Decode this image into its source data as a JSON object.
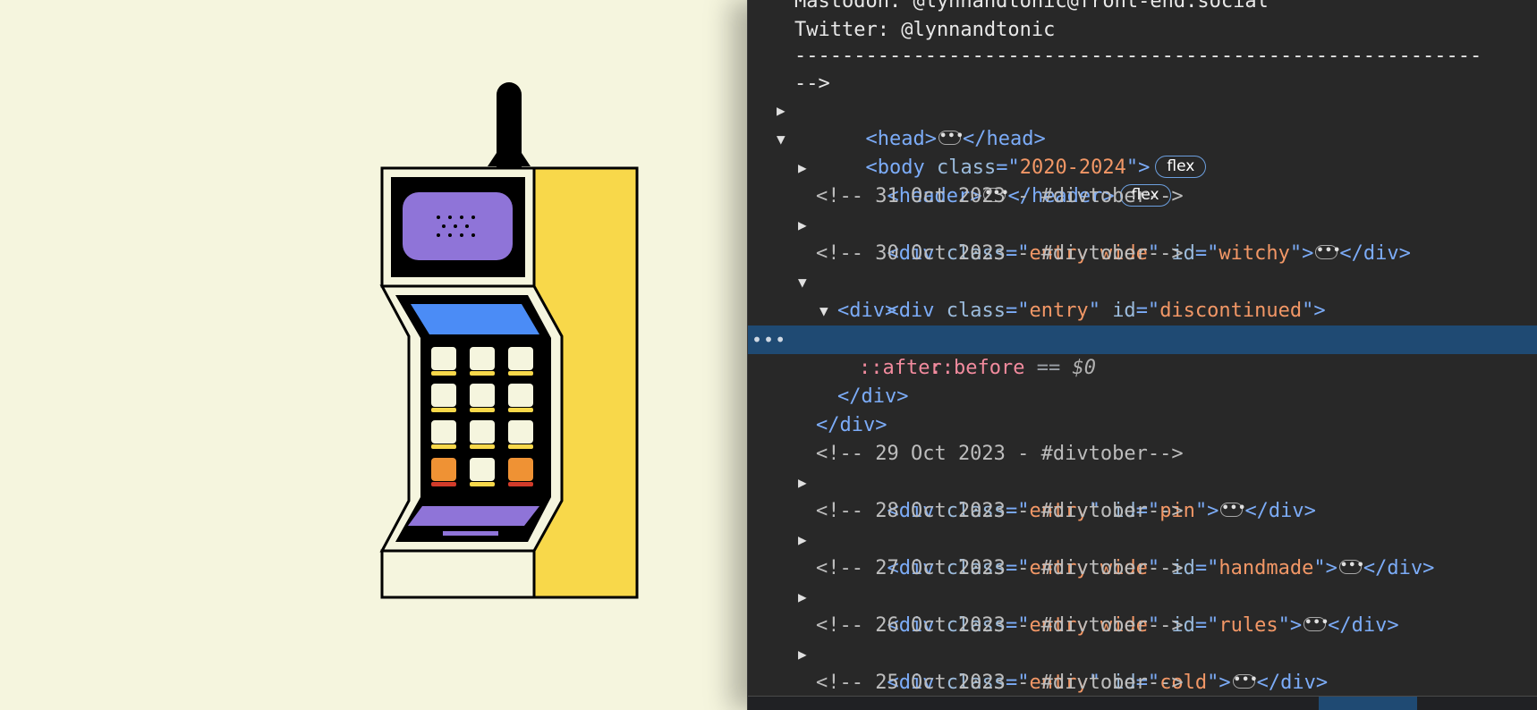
{
  "devtools": {
    "lines": [
      {
        "id": "l0",
        "text": "Mastodon: @lynnandtonic@front-end.social"
      },
      {
        "id": "l1",
        "text": "Twitter: @lynnandtonic"
      },
      {
        "id": "l2",
        "text": "----------------------------------------------------------"
      },
      {
        "id": "l3",
        "text": "-->"
      },
      {
        "id": "l4",
        "open": "<head>",
        "close": "</head>"
      },
      {
        "id": "l5",
        "tag": "<body",
        "attr": "class",
        "value": "2020-2024",
        "end": ">",
        "badge": "flex"
      },
      {
        "id": "l6",
        "open": "<header>",
        "close": "</header>",
        "badge": "flex"
      },
      {
        "id": "l7",
        "comment": "<!-- 31 Oct 2023 - #divtober-->"
      },
      {
        "id": "l8",
        "tag": "<div",
        "attr": "class",
        "value": "entry wide",
        "attr2": "id",
        "value2": "witchy",
        "close": "</div>"
      },
      {
        "id": "l9",
        "comment": "<!-- 30 Oct 2023 - #divtober-->"
      },
      {
        "id": "l10",
        "tag": "<div",
        "attr": "class",
        "value": "entry",
        "attr2": "id",
        "value2": "discontinued",
        "end": ">"
      },
      {
        "id": "l11",
        "tag": "<div>"
      },
      {
        "id": "l12",
        "pseudo": "::before",
        "eq": "==",
        "var": "$0"
      },
      {
        "id": "l13",
        "pseudo": "::after"
      },
      {
        "id": "l14",
        "tag": "</div>"
      },
      {
        "id": "l15",
        "tag": "</div>"
      },
      {
        "id": "l16",
        "comment": "<!-- 29 Oct 2023 - #divtober-->"
      },
      {
        "id": "l17",
        "tag": "<div",
        "attr": "class",
        "value": "entry",
        "attr2": "id",
        "value2": "pin",
        "close": "</div>"
      },
      {
        "id": "l18",
        "comment": "<!-- 28 Oct 2023 - #divtober-->"
      },
      {
        "id": "l19",
        "tag": "<div",
        "attr": "class",
        "value": "entry wide",
        "attr2": "id",
        "value2": "handmade",
        "close": "</div>"
      },
      {
        "id": "l20",
        "comment": "<!-- 27 Oct 2023 - #divtober-->"
      },
      {
        "id": "l21",
        "tag": "<div",
        "attr": "class",
        "value": "entry wide",
        "attr2": "id",
        "value2": "rules",
        "close": "</div>"
      },
      {
        "id": "l22",
        "comment": "<!-- 26 Oct 2023 - #divtober-->"
      },
      {
        "id": "l23",
        "tag": "<div",
        "attr": "class",
        "value": "entry",
        "attr2": "id",
        "value2": "cold",
        "close": "</div>"
      },
      {
        "id": "l24",
        "comment": "<!-- 25 Oct 2023 - #divtober-->"
      }
    ],
    "gutter_dots": "•••",
    "ellipsis": "•••"
  },
  "colors": {
    "page_bg": "#f5f5de",
    "phone_purple": "#8f74d8",
    "phone_blue": "#4b8cf6",
    "phone_yellow": "#f8d84a",
    "key_orange": "#ef9234",
    "devtools_bg": "#282828",
    "selection": "#1f4a73"
  }
}
